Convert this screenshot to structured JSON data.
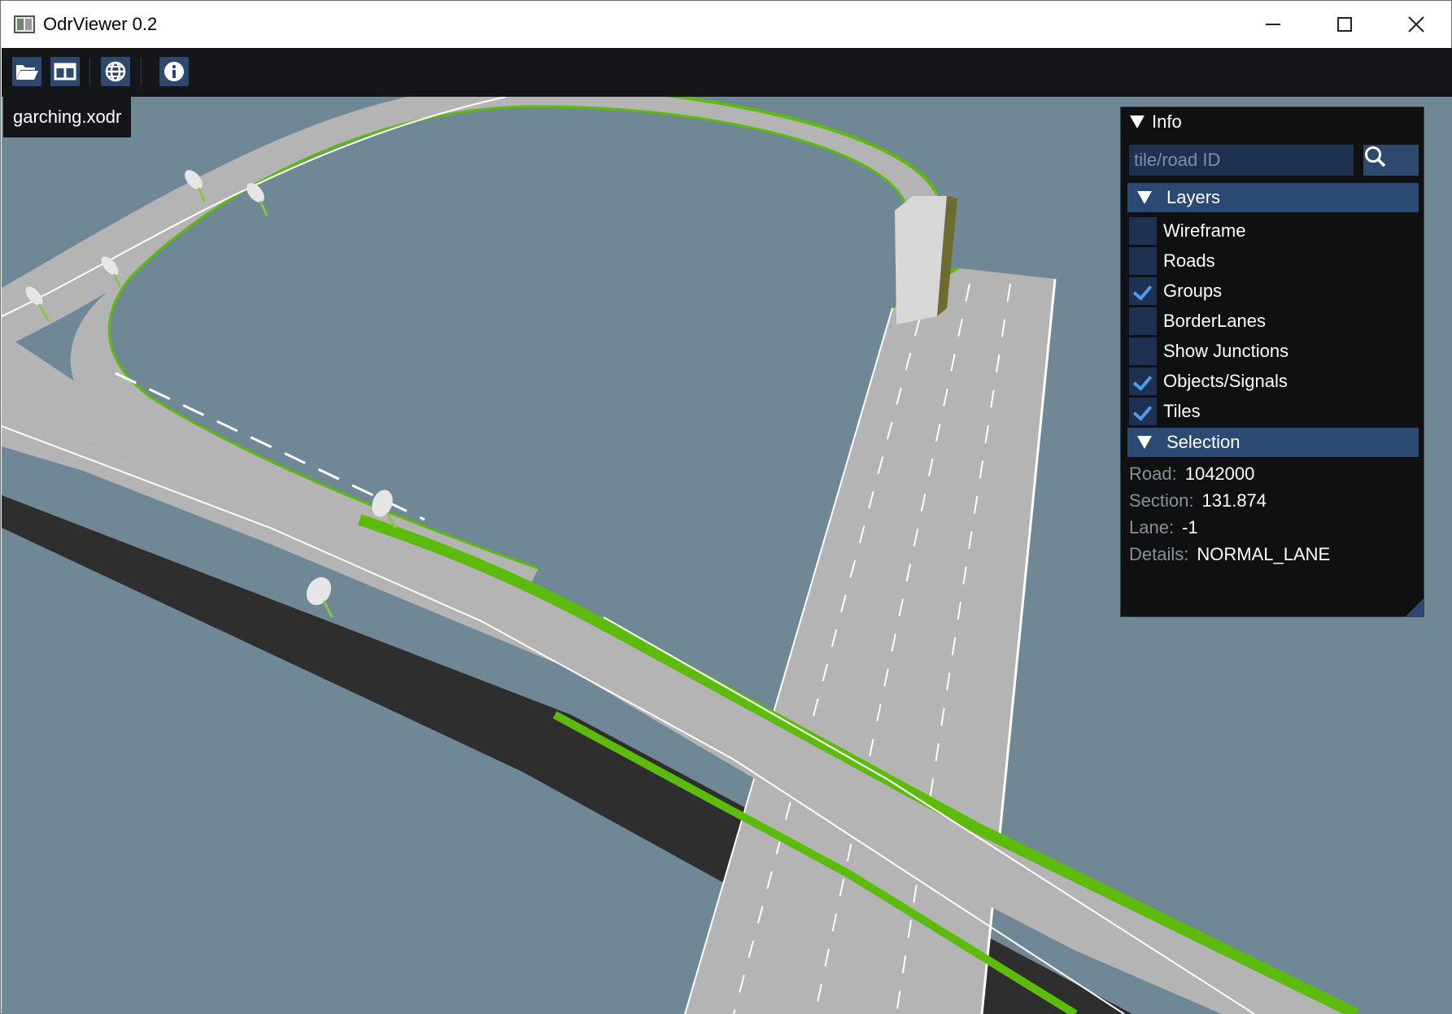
{
  "window": {
    "title": "OdrViewer 0.2"
  },
  "toolbar": {
    "buttons": [
      {
        "icon": "folder-open-icon"
      },
      {
        "icon": "split-view-icon"
      },
      {
        "icon": "globe-icon"
      },
      {
        "icon": "info-icon"
      }
    ]
  },
  "viewport": {
    "file_label": "garching.xodr",
    "colors": {
      "background": "#708896",
      "road": "#b4b4b4",
      "grass": "#5dbb0e",
      "shadow": "#2e2e2e",
      "olive": "#6f6a2e"
    }
  },
  "info_panel": {
    "title": "Info",
    "search": {
      "placeholder": "tile/road ID",
      "value": ""
    },
    "layers": {
      "title": "Layers",
      "items": [
        {
          "label": "Wireframe",
          "checked": false
        },
        {
          "label": "Roads",
          "checked": false
        },
        {
          "label": "Groups",
          "checked": true
        },
        {
          "label": "BorderLanes",
          "checked": false
        },
        {
          "label": "Show Junctions",
          "checked": false
        },
        {
          "label": "Objects/Signals",
          "checked": true
        },
        {
          "label": "Tiles",
          "checked": true
        }
      ]
    },
    "selection": {
      "title": "Selection",
      "road_key": "Road:",
      "road_value": "1042000",
      "section_key": "Section:",
      "section_value": "131.874",
      "lane_key": "Lane:",
      "lane_value": "-1",
      "details_key": "Details:",
      "details_value": "NORMAL_LANE"
    }
  }
}
